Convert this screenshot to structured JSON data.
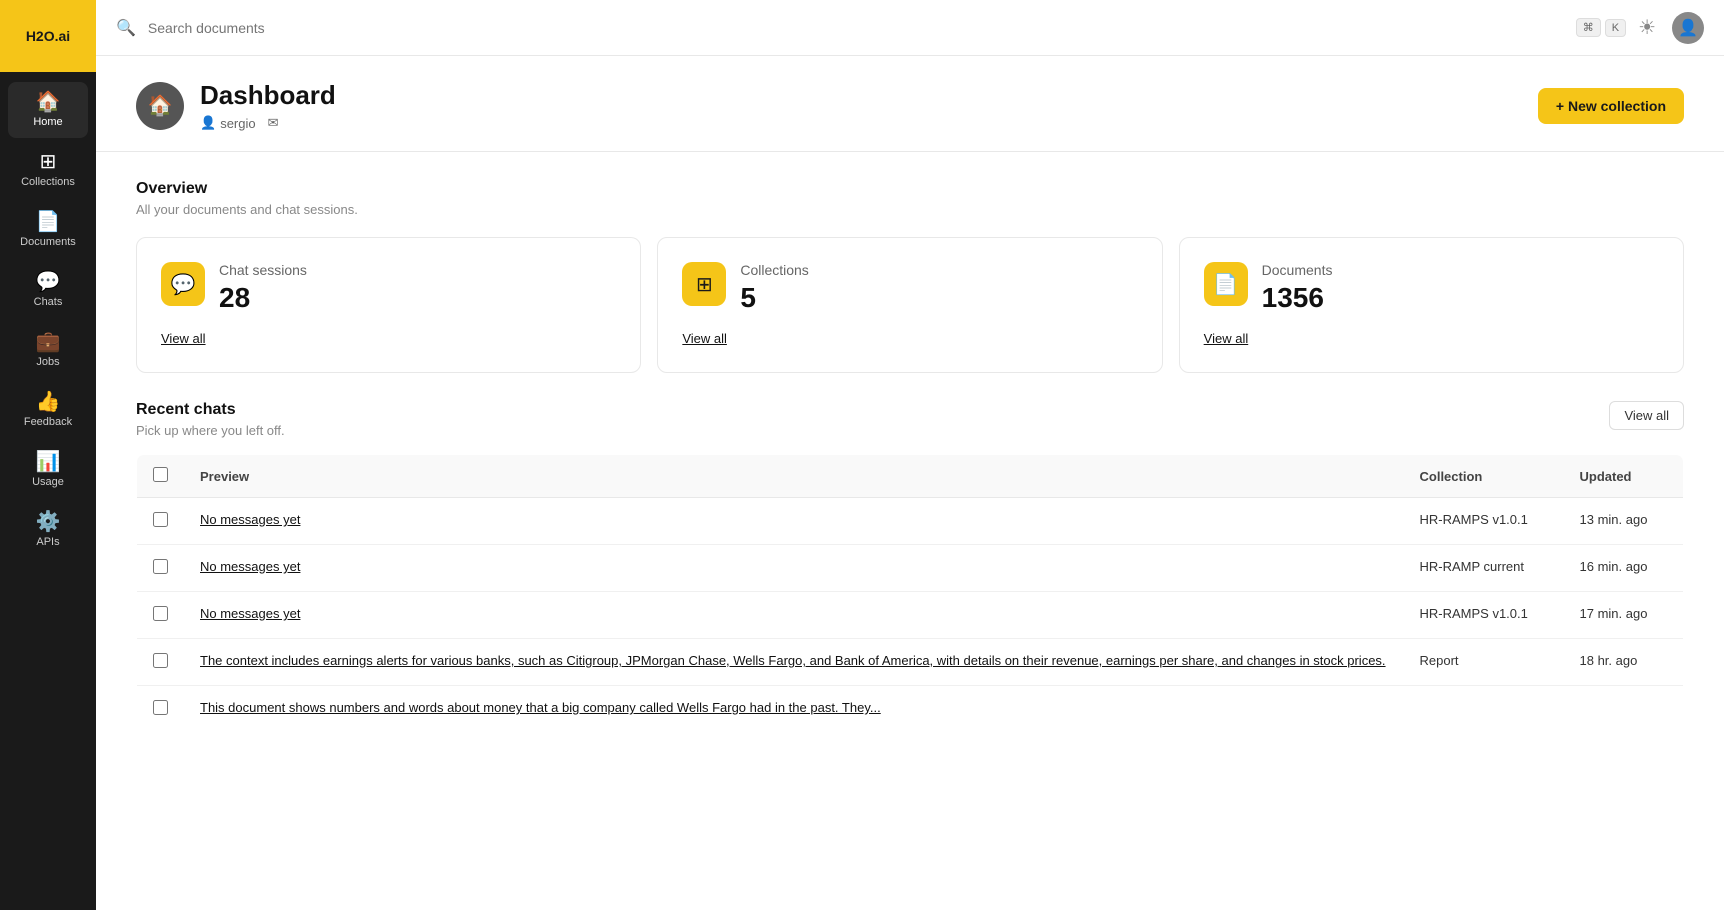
{
  "app": {
    "logo": "H2O.ai"
  },
  "sidebar": {
    "items": [
      {
        "id": "home",
        "label": "Home",
        "icon": "🏠",
        "active": true
      },
      {
        "id": "collections",
        "label": "Collections",
        "icon": "⊞",
        "active": false
      },
      {
        "id": "documents",
        "label": "Documents",
        "icon": "📄",
        "active": false
      },
      {
        "id": "chats",
        "label": "Chats",
        "icon": "💬",
        "active": false
      },
      {
        "id": "jobs",
        "label": "Jobs",
        "icon": "💼",
        "active": false
      },
      {
        "id": "feedback",
        "label": "Feedback",
        "icon": "👍",
        "active": false
      },
      {
        "id": "usage",
        "label": "Usage",
        "icon": "📊",
        "active": false
      },
      {
        "id": "apis",
        "label": "APIs",
        "icon": "⚙️",
        "active": false
      }
    ]
  },
  "topbar": {
    "search_placeholder": "Search documents",
    "shortcut_key1": "⌘",
    "shortcut_key2": "K"
  },
  "dashboard": {
    "title": "Dashboard",
    "user": "sergio",
    "new_collection_label": "+ New collection"
  },
  "overview": {
    "title": "Overview",
    "subtitle": "All your documents and chat sessions.",
    "stats": [
      {
        "id": "chat-sessions",
        "label": "Chat sessions",
        "value": "28",
        "view_all": "View all"
      },
      {
        "id": "collections",
        "label": "Collections",
        "value": "5",
        "view_all": "View all"
      },
      {
        "id": "documents",
        "label": "Documents",
        "value": "1356",
        "view_all": "View all"
      }
    ]
  },
  "recent_chats": {
    "title": "Recent chats",
    "subtitle": "Pick up where you left off.",
    "view_all_label": "View all",
    "columns": {
      "preview": "Preview",
      "collection": "Collection",
      "updated": "Updated"
    },
    "rows": [
      {
        "id": "row1",
        "preview": "No messages yet",
        "collection": "HR-RAMPS v1.0.1",
        "updated": "13 min. ago"
      },
      {
        "id": "row2",
        "preview": "No messages yet",
        "collection": "HR-RAMP current",
        "updated": "16 min. ago"
      },
      {
        "id": "row3",
        "preview": "No messages yet",
        "collection": "HR-RAMPS v1.0.1",
        "updated": "17 min. ago"
      },
      {
        "id": "row4",
        "preview": "The context includes earnings alerts for various banks, such as Citigroup, JPMorgan Chase, Wells Fargo, and Bank of America, with details on their revenue, earnings per share, and changes in stock prices.",
        "collection": "Report",
        "updated": "18 hr. ago"
      },
      {
        "id": "row5",
        "preview": "This document shows numbers and words about money that a big company called Wells Fargo had in the past. They...",
        "collection": "",
        "updated": ""
      }
    ]
  }
}
